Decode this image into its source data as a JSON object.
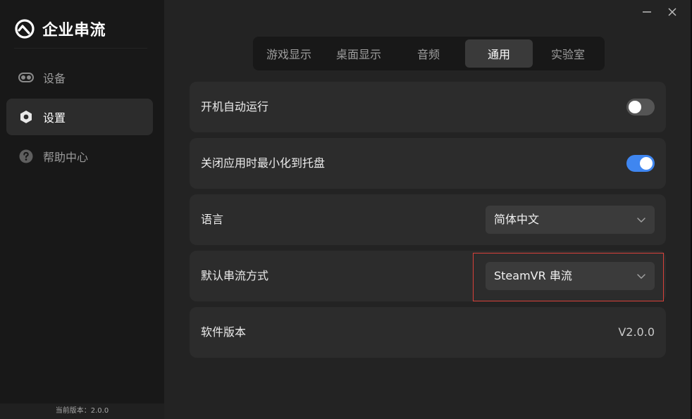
{
  "app": {
    "title": "企业串流",
    "footer_version": "当前版本：2.0.0"
  },
  "sidebar": {
    "items": [
      {
        "label": "设备",
        "icon": "vr-headset-icon",
        "active": false
      },
      {
        "label": "设置",
        "icon": "settings-icon",
        "active": true
      },
      {
        "label": "帮助中心",
        "icon": "help-icon",
        "active": false
      }
    ]
  },
  "tabs": [
    {
      "label": "游戏显示",
      "active": false
    },
    {
      "label": "桌面显示",
      "active": false
    },
    {
      "label": "音频",
      "active": false
    },
    {
      "label": "通用",
      "active": true
    },
    {
      "label": "实验室",
      "active": false
    }
  ],
  "settings": {
    "auto_start": {
      "label": "开机自动运行",
      "value": false
    },
    "minimize_to_tray": {
      "label": "关闭应用时最小化到托盘",
      "value": true
    },
    "language": {
      "label": "语言",
      "value": "简体中文"
    },
    "stream_mode": {
      "label": "默认串流方式",
      "value": "SteamVR 串流"
    },
    "version": {
      "label": "软件版本",
      "value": "V2.0.0"
    }
  },
  "colors": {
    "accent": "#3f86f0",
    "highlight": "#d9413a",
    "sidebar_bg": "#181818",
    "main_bg": "#232323",
    "card_bg": "#2c2c2c"
  }
}
